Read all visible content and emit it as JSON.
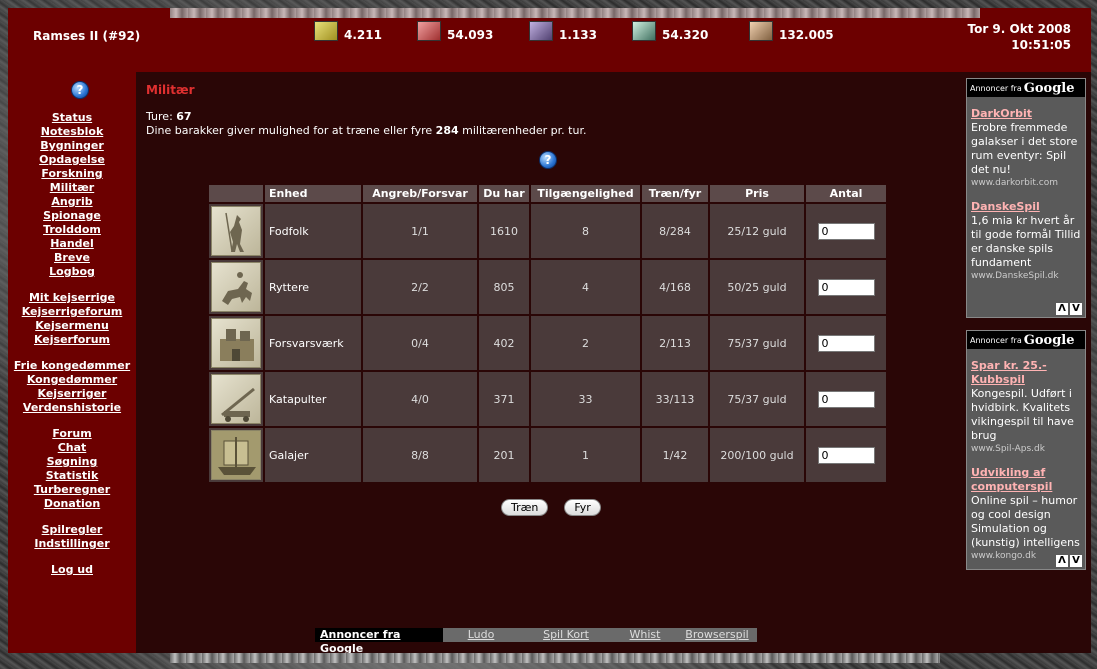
{
  "header": {
    "player_name": "Ramses II (#92)",
    "resources": [
      {
        "icon": "gold-icon",
        "value": "4.211",
        "color": "#c8c040"
      },
      {
        "icon": "food-icon",
        "value": "54.093",
        "color": "#c05050"
      },
      {
        "icon": "mana-icon",
        "value": "1.133",
        "color": "#8070a0"
      },
      {
        "icon": "land-icon",
        "value": "54.320",
        "color": "#70a090"
      },
      {
        "icon": "power-icon",
        "value": "132.005",
        "color": "#c09070"
      }
    ],
    "date": "Tor 9. Okt 2008",
    "time": "10:51:05"
  },
  "sidebar": {
    "groups": [
      [
        "Status",
        "Notesblok",
        "Bygninger",
        "Opdagelse",
        "Forskning",
        "Militær",
        "Angrib",
        "Spionage",
        "Trolddom",
        "Handel",
        "Breve",
        "Logbog"
      ],
      [
        "Mit kejserrige",
        "Kejserrigeforum",
        "Kejsermenu",
        "Kejserforum"
      ],
      [
        "Frie kongedømmer",
        "Kongedømmer",
        "Kejserriger",
        "Verdenshistorie"
      ],
      [
        "Forum",
        "Chat",
        "Søgning",
        "Statistik",
        "Turberegner",
        "Donation"
      ],
      [
        "Spilregler",
        "Indstillinger"
      ],
      [
        "Log ud"
      ]
    ]
  },
  "main": {
    "title": "Militær",
    "turns_label": "Ture:",
    "turns_value": "67",
    "desc_pre": "Dine barakker giver mulighed for at træne eller fyre",
    "desc_value": "284",
    "desc_post": "militærenheder pr. tur.",
    "columns": [
      "",
      "Enhed",
      "Angreb/Forsvar",
      "Du har",
      "Tilgængelighed",
      "Træn/fyr",
      "Pris",
      "Antal"
    ],
    "units": [
      {
        "name": "Fodfolk",
        "attack_defense": "1/1",
        "have": "1610",
        "availability": "8",
        "train_fire": "8/284",
        "price": "25/12 guld",
        "qty": "0"
      },
      {
        "name": "Ryttere",
        "attack_defense": "2/2",
        "have": "805",
        "availability": "4",
        "train_fire": "4/168",
        "price": "50/25 guld",
        "qty": "0"
      },
      {
        "name": "Forsvarsværk",
        "attack_defense": "0/4",
        "have": "402",
        "availability": "2",
        "train_fire": "2/113",
        "price": "75/37 guld",
        "qty": "0"
      },
      {
        "name": "Katapulter",
        "attack_defense": "4/0",
        "have": "371",
        "availability": "33",
        "train_fire": "33/113",
        "price": "75/37 guld",
        "qty": "0"
      },
      {
        "name": "Galajer",
        "attack_defense": "8/8",
        "have": "201",
        "availability": "1",
        "train_fire": "1/42",
        "price": "200/100 guld",
        "qty": "0"
      }
    ],
    "train_button": "Træn",
    "fire_button": "Fyr"
  },
  "ads": {
    "header_prefix": "Annoncer fra",
    "header_brand": "Google",
    "box1": [
      {
        "title": "DarkOrbit",
        "desc": "Erobre fremmede galakser i det store rum eventyr: Spil det nu!",
        "url": "www.darkorbit.com"
      },
      {
        "title": "DanskeSpil",
        "desc": "1,6 mia kr hvert år til gode formål Tillid er danske spils fundament",
        "url": "www.DanskeSpil.dk"
      }
    ],
    "box2": [
      {
        "title": "Spar kr. 25.- Kubbspil",
        "desc": "Kongespil. Udført i hvidbirk. Kvalitets vikingespil til have brug",
        "url": "www.Spil-Aps.dk"
      },
      {
        "title": "Udvikling af computerspil",
        "desc": "Online spil – humor og cool design Simulation og (kunstig) intelligens",
        "url": "www.kongo.dk"
      }
    ],
    "nav_up": "Λ",
    "nav_down": "V"
  },
  "footer": {
    "label": "Annoncer fra Google",
    "links": [
      "Ludo",
      "Spil Kort",
      "Whist",
      "Browserspil"
    ]
  }
}
